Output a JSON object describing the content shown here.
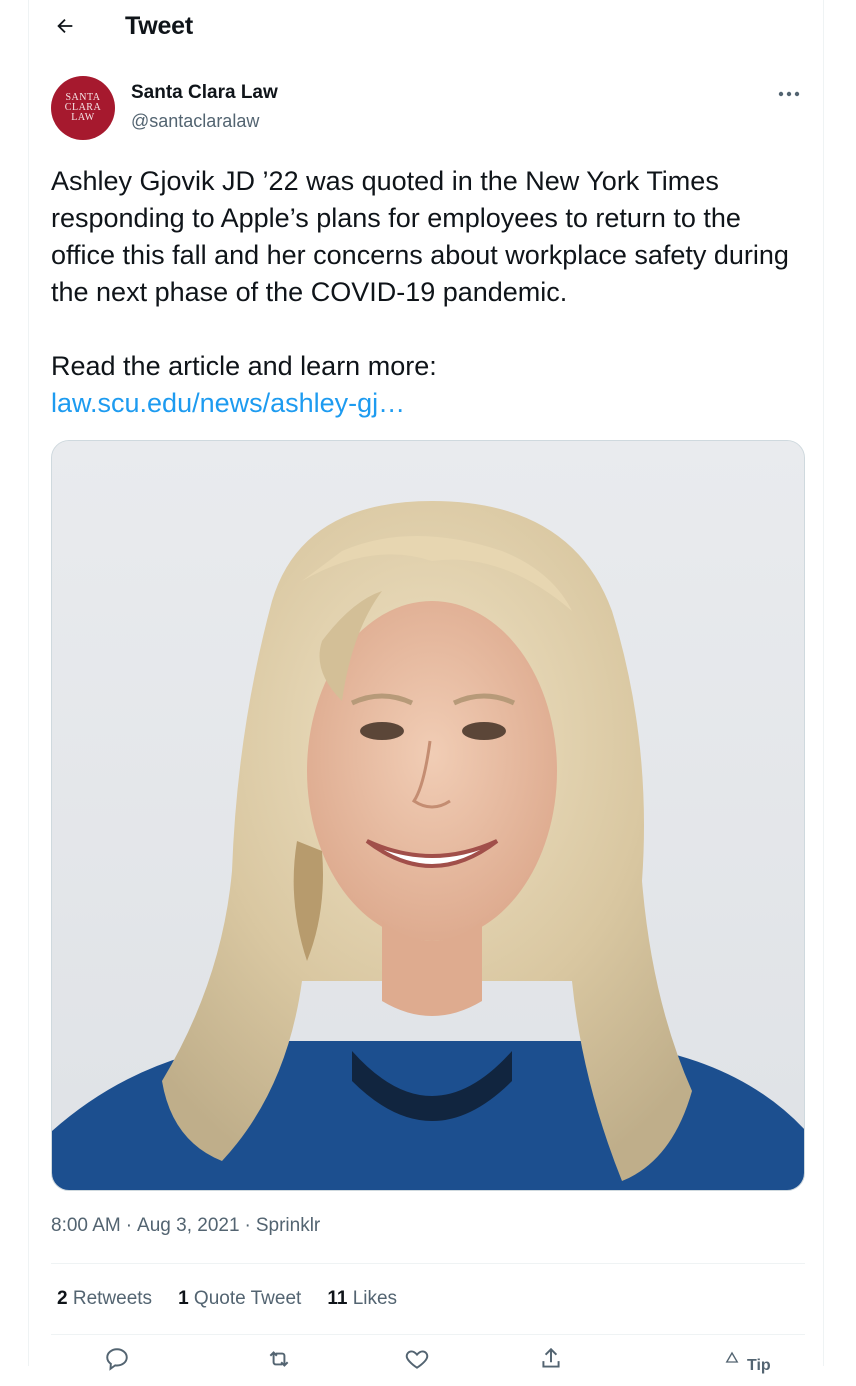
{
  "header": {
    "title": "Tweet",
    "back_icon": "arrow-left-icon"
  },
  "author": {
    "name": "Santa Clara Law",
    "handle": "@santaclaralaw",
    "avatar_text": [
      "SANTA",
      "CLARA",
      "LAW"
    ],
    "avatar_color": "#a6192e"
  },
  "tweet": {
    "paragraph1": "Ashley Gjovik JD ’22 was quoted in the New York Times responding to Apple’s plans for employees to return to the office this fall and her concerns about workplace safety during the next phase of the COVID-19 pandemic.",
    "paragraph2": "Read the article and learn more:",
    "link": "law.scu.edu/news/ashley-gj…",
    "link_color": "#1d9bf0"
  },
  "meta": {
    "time": "8:00 AM",
    "date": "Aug 3, 2021",
    "source": "Sprinklr"
  },
  "stats": {
    "retweets_count": "2",
    "retweets_label": "Retweets",
    "quotes_count": "1",
    "quotes_label": "Quote Tweet",
    "likes_count": "11",
    "likes_label": "Likes"
  },
  "actions": {
    "reply_icon": "reply-icon",
    "retweet_icon": "retweet-icon",
    "like_icon": "heart-icon",
    "share_icon": "share-icon",
    "tip_label": "Tip"
  }
}
